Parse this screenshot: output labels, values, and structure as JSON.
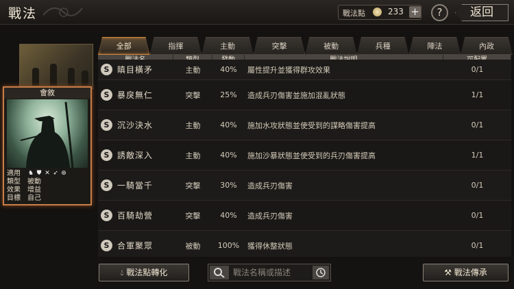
{
  "header": {
    "title": "戰法",
    "points_label": "戰法點",
    "points_value": "233",
    "plus": "+",
    "help": "?",
    "back": "返回"
  },
  "card": {
    "title": "會敘",
    "stats": [
      {
        "key": "適用",
        "value": ""
      },
      {
        "key": "類型",
        "value": "被動"
      },
      {
        "key": "效果",
        "value": "增益"
      },
      {
        "key": "目標",
        "value": "自己"
      }
    ],
    "type_icons": [
      "horse-icon",
      "shield-icon",
      "crossed-swords-icon",
      "bow-icon",
      "wheel-icon"
    ]
  },
  "tabs": [
    "全部",
    "指揮",
    "主動",
    "突擊",
    "被動",
    "兵種",
    "陣法",
    "內政"
  ],
  "columns": [
    "戰法名",
    "類型",
    "發動",
    "戰法說明",
    "可配置"
  ],
  "rows": [
    {
      "name": "瞋目橫矛",
      "type": "主動",
      "rate": "40%",
      "desc": "屬性提升並獲得群攻效果",
      "avail": "0/1",
      "avail_color": "#c73b30"
    },
    {
      "name": "暴戾無仁",
      "type": "突擊",
      "rate": "25%",
      "desc": "造成兵刃傷害並施加混亂狀態",
      "avail": "1/1",
      "avail_color": "#d6cebe"
    },
    {
      "name": "沉沙決水",
      "type": "主動",
      "rate": "40%",
      "desc": "施加水攻狀態並使受到的謀略傷害提高",
      "avail": "0/1",
      "avail_color": "#c73b30"
    },
    {
      "name": "誘敵深入",
      "type": "主動",
      "rate": "40%",
      "desc": "施加沙暴狀態並使受到的兵刃傷害提高",
      "avail": "1/1",
      "avail_color": "#d6cebe"
    },
    {
      "name": "一騎當千",
      "type": "突擊",
      "rate": "30%",
      "desc": "造成兵刃傷害",
      "avail": "0/1",
      "avail_color": "#c73b30"
    },
    {
      "name": "百騎劫營",
      "type": "突擊",
      "rate": "40%",
      "desc": "造成兵刃傷害",
      "avail": "0/1",
      "avail_color": "#c73b30"
    },
    {
      "name": "合軍聚眾",
      "type": "被動",
      "rate": "100%",
      "desc": "獲得休整狀態",
      "avail": "0/1",
      "avail_color": "#c73b30"
    }
  ],
  "footer": {
    "convert": "戰法點轉化",
    "search_placeholder": "戰法名稱或描述",
    "inherit": "戰法傳承"
  }
}
